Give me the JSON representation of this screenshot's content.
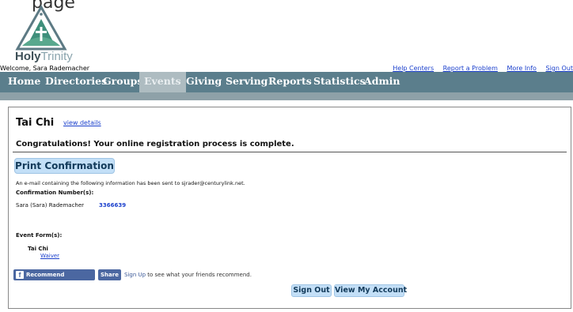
{
  "page_top_text": "page",
  "logo": {
    "holy": "Holy",
    "trinity": "Trinity"
  },
  "header": {
    "welcome": "Welcome, Sara Rademacher",
    "links": [
      "Help Centers",
      "Report a Problem",
      "More Info",
      "Sign Out"
    ]
  },
  "nav": {
    "items": [
      "Home",
      "Directories",
      "Groups",
      "Events",
      "Giving",
      "Serving",
      "Reports",
      "Statistics",
      "Admin"
    ],
    "active": "Events"
  },
  "event": {
    "title": "Tai Chi",
    "view_details": "view details"
  },
  "registration": {
    "congrats": "Congratulations! Your online registration process is complete.",
    "print_label": "Print Confirmation",
    "email_message": "An e-mail containing the following information has been sent to sjrader@centurylink.net.",
    "confirmation_label": "Confirmation Number(s):",
    "registrant_name": "Sara (Sara) Rademacher",
    "confirmation_number": "3366639",
    "forms_label": "Event Form(s):",
    "form_event": "Tai Chi",
    "form_link": "Waiver"
  },
  "social": {
    "recommend": "Recommend",
    "share": "Share",
    "signup": "Sign Up",
    "signup_suffix": " to see what your friends recommend."
  },
  "actions": {
    "sign_out": "Sign Out",
    "view_account": "View My Account"
  },
  "colors": {
    "navbar": "#5b7e8c",
    "button": "#c3dff7",
    "link": "#1a3fcc",
    "facebook": "#4b67a1"
  }
}
